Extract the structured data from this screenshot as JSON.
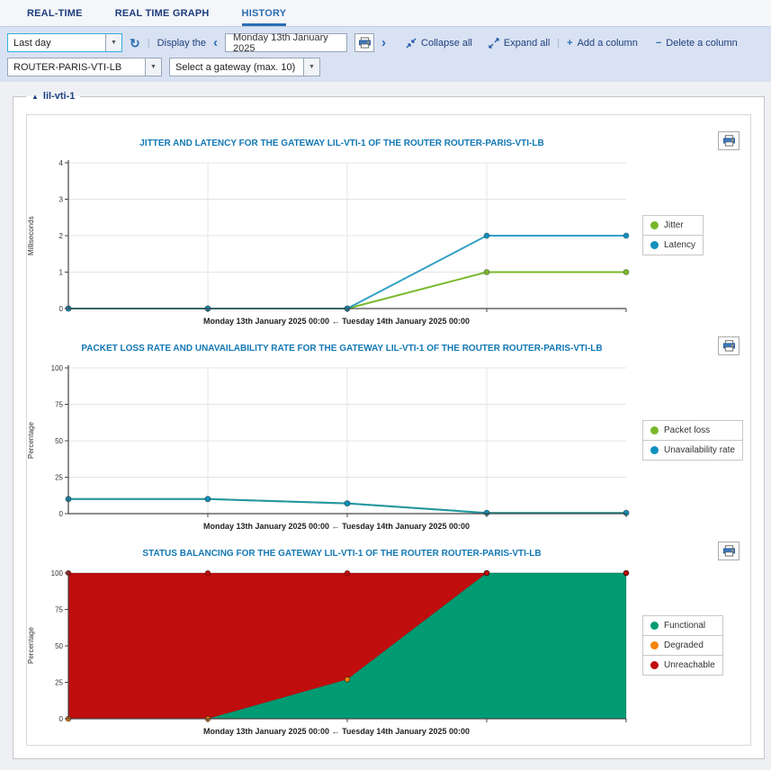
{
  "tabs": [
    {
      "label": "REAL-TIME",
      "active": false
    },
    {
      "label": "REAL TIME GRAPH",
      "active": false
    },
    {
      "label": "HISTORY",
      "active": true
    }
  ],
  "toolbar": {
    "period_value": "Last day",
    "display_label": "Display the",
    "prev_glyph": "‹",
    "next_glyph": "›",
    "date_value": "Monday 13th January 2025",
    "collapse_all_label": "Collapse all",
    "expand_all_label": "Expand all",
    "add_column_label": "Add a column",
    "delete_column_label": "Delete a column",
    "add_glyph": "+",
    "delete_glyph": "−",
    "refresh_glyph": "↻",
    "router_value": "ROUTER-PARIS-VTI-LB",
    "gateway_placeholder": "Select a gateway (max. 10)"
  },
  "panel": {
    "gateway_name": "lil-vti-1",
    "collapse_glyph": "▲"
  },
  "colors": {
    "accent_blue": "#2a6db5",
    "title_blue": "#1278b4",
    "toolbar_bg": "#d9e2f2"
  },
  "chart_data": [
    {
      "type": "line",
      "title": "JITTER AND LATENCY FOR THE GATEWAY LIL-VTI-1 OF THE ROUTER ROUTER-PARIS-VTI-LB",
      "ylabel": "Milliseconds",
      "xlabel": "Monday 13th January 2025 00:00 ← Tuesday 14th January 2025 00:00",
      "ylim": [
        0,
        4
      ],
      "yticks": [
        0,
        1,
        2,
        3,
        4
      ],
      "grid": true,
      "legend_position": "right",
      "series": [
        {
          "name": "Jitter",
          "color": "#79b82a",
          "values": [
            0,
            0,
            0,
            1,
            1
          ]
        },
        {
          "name": "Latency",
          "color": "#1090bc",
          "values": [
            0,
            0,
            0,
            2,
            2
          ]
        }
      ]
    },
    {
      "type": "line",
      "title": "PACKET LOSS RATE AND UNAVAILABILITY RATE FOR THE GATEWAY LIL-VTI-1 OF THE ROUTER ROUTER-PARIS-VTI-LB",
      "ylabel": "Percentage",
      "xlabel": "Monday 13th January 2025 00:00 ← Tuesday 14th January 2025 00:00",
      "ylim": [
        0,
        100
      ],
      "yticks": [
        0,
        25,
        50,
        75,
        100
      ],
      "grid": true,
      "legend_position": "right",
      "series": [
        {
          "name": "Packet loss",
          "color": "#79b82a",
          "values": [
            10,
            10,
            7,
            0.5,
            0.5
          ]
        },
        {
          "name": "Unavailability rate",
          "color": "#1090bc",
          "values": [
            10,
            10,
            7,
            0.5,
            0.5
          ]
        }
      ]
    },
    {
      "type": "area",
      "title": "STATUS BALANCING FOR THE GATEWAY LIL-VTI-1 OF THE ROUTER ROUTER-PARIS-VTI-LB",
      "ylabel": "Percentage",
      "xlabel": "Monday 13th January 2025 00:00 ← Tuesday 14th January 2025 00:00",
      "ylim": [
        0,
        100
      ],
      "yticks": [
        0,
        25,
        50,
        75,
        100
      ],
      "grid": true,
      "stacked": true,
      "legend_position": "right",
      "series": [
        {
          "name": "Functional",
          "color": "#009b72",
          "values": [
            0,
            0,
            27,
            100,
            100
          ]
        },
        {
          "name": "Degraded",
          "color": "#f5820b",
          "values": [
            0,
            0,
            0,
            0,
            0
          ]
        },
        {
          "name": "Unreachable",
          "color": "#c00d0d",
          "values": [
            100,
            100,
            73,
            0,
            0
          ]
        }
      ]
    }
  ]
}
